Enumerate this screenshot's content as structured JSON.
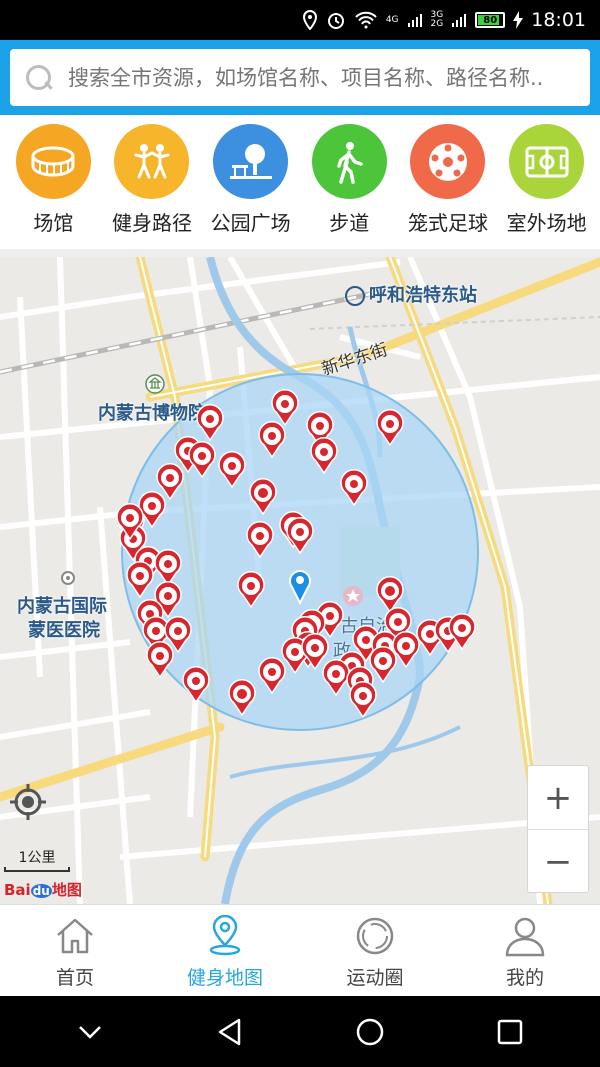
{
  "status_bar": {
    "time": "18:01",
    "battery": "80",
    "net_4g": "4G",
    "net_3g": "3G",
    "net_2g": "2G"
  },
  "search": {
    "placeholder": "搜索全市资源，如场馆名称、项目名称、路径名称.."
  },
  "categories": [
    {
      "label": "场馆",
      "icon": "stadium-icon",
      "color": "#f5a623"
    },
    {
      "label": "健身路径",
      "icon": "fitness-people-icon",
      "color": "#f7b52c"
    },
    {
      "label": "公园广场",
      "icon": "park-tree-icon",
      "color": "#3d8fe0"
    },
    {
      "label": "步道",
      "icon": "walking-icon",
      "color": "#4cc53b"
    },
    {
      "label": "笼式足球",
      "icon": "soccer-ball-icon",
      "color": "#f06a4a"
    },
    {
      "label": "室外场地",
      "icon": "outdoor-field-icon",
      "color": "#a9d43a"
    }
  ],
  "map": {
    "labels": {
      "east_station": "呼和浩特东站",
      "xinhua_street": "新华东街",
      "museum": "内蒙古博物院",
      "hospital_line1": "内蒙古国际",
      "hospital_line2": "蒙医医院",
      "government_1": "古自治",
      "government_2": "政"
    },
    "scale_label": "1公里",
    "zoom_in": "+",
    "zoom_out": "−",
    "logo": "Baidu地图",
    "logo_bai": "Bai",
    "logo_du": "du",
    "logo_map": "地图",
    "marker_color": "#d7262d",
    "radius_fill": "#a9d6f5",
    "user_dot_color": "#1b8fe6"
  },
  "bottom_nav": [
    {
      "label": "首页",
      "icon": "home-icon",
      "active": false
    },
    {
      "label": "健身地图",
      "icon": "map-pin-icon",
      "active": true
    },
    {
      "label": "运动圈",
      "icon": "circle-icon",
      "active": false
    },
    {
      "label": "我的",
      "icon": "user-icon",
      "active": false
    }
  ],
  "accent_color": "#1ba2e9"
}
